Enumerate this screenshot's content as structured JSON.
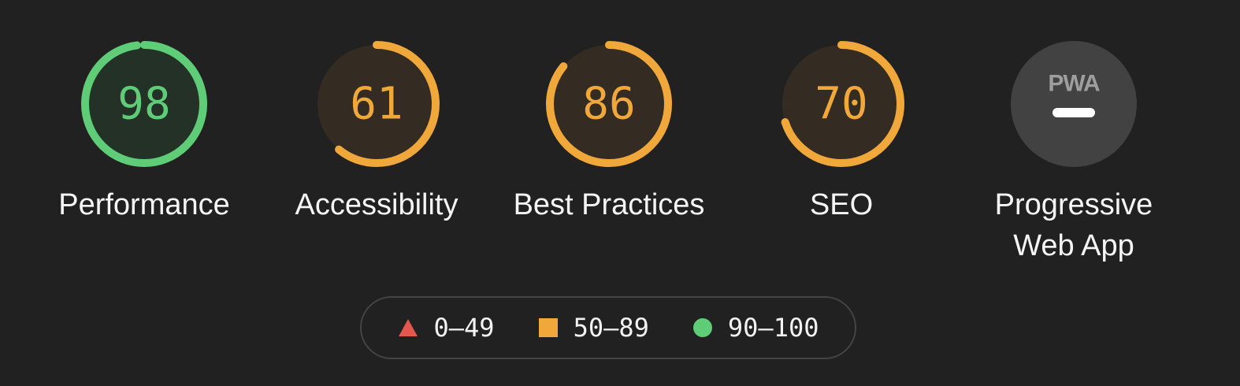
{
  "categories": [
    {
      "id": "performance",
      "label": "Performance",
      "score": 98,
      "rating": "pass"
    },
    {
      "id": "accessibility",
      "label": "Accessibility",
      "score": 61,
      "rating": "average"
    },
    {
      "id": "best_practices",
      "label": "Best Practices",
      "score": 86,
      "rating": "average"
    },
    {
      "id": "seo",
      "label": "SEO",
      "score": 70,
      "rating": "average"
    },
    {
      "id": "pwa",
      "label": "Progressive Web App",
      "badge": "PWA",
      "status": "not applicable"
    }
  ],
  "legend": [
    {
      "shape": "triangle",
      "range": "0–49",
      "color": "#e4574c"
    },
    {
      "shape": "square",
      "range": "50–89",
      "color": "#f0a83a"
    },
    {
      "shape": "circle",
      "range": "90–100",
      "color": "#5fcd78"
    }
  ],
  "colors": {
    "pass": "#5fcd78",
    "average": "#f0a83a",
    "fail": "#e4574c",
    "background": "#212121",
    "pass_fill": "#243127",
    "average_fill": "#342b22",
    "pwa_fill": "#424242"
  }
}
